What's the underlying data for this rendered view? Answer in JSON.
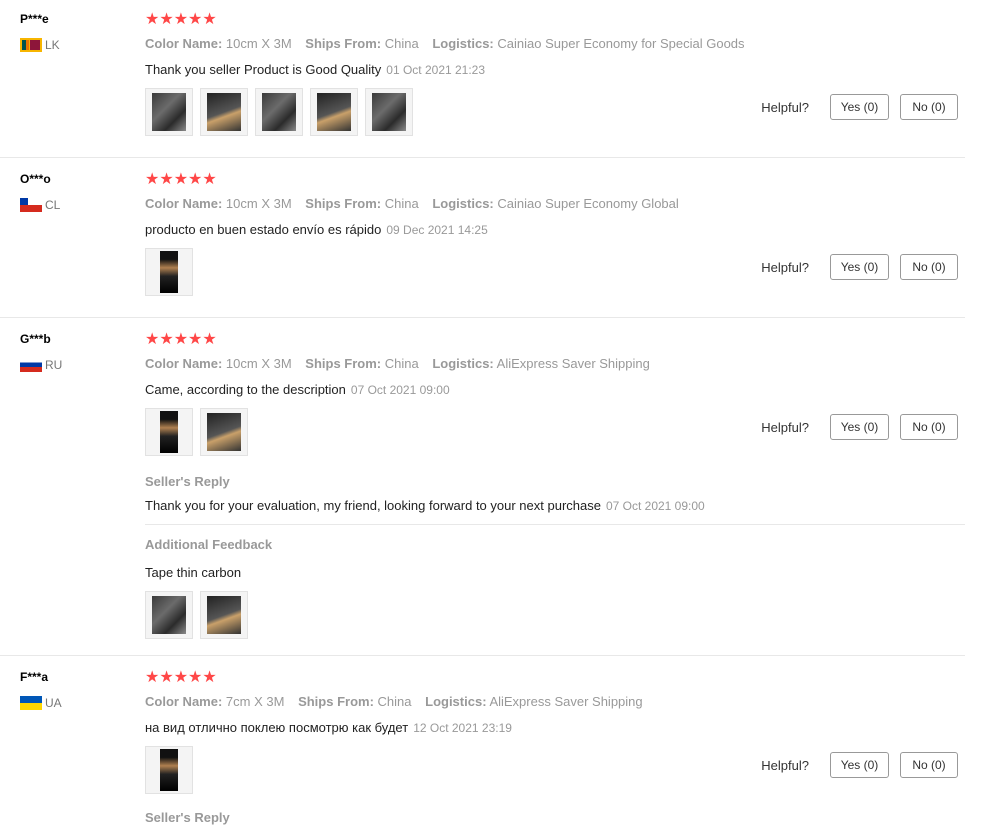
{
  "labels": {
    "color_name": "Color Name:",
    "ships_from": "Ships From:",
    "logistics": "Logistics:",
    "helpful": "Helpful?",
    "stars": "★★★★★"
  },
  "reviews": [
    {
      "user": "P***e",
      "country": "LK",
      "color": "10cm X 3M",
      "ships": "China",
      "logistics": "Cainiao Super Economy for Special Goods",
      "text": "Thank you seller Product is Good Quality",
      "date": "01 Oct 2021 21:23",
      "yes": "Yes (0)",
      "no": "No (0)",
      "rating": 5
    },
    {
      "user": "O***o",
      "country": "CL",
      "color": "10cm X 3M",
      "ships": "China",
      "logistics": "Cainiao Super Economy Global",
      "text": "producto en buen estado envío es rápido",
      "date": "09 Dec 2021 14:25",
      "yes": "Yes (0)",
      "no": "No (0)",
      "rating": 5
    },
    {
      "user": "G***b",
      "country": "RU",
      "color": "10cm X 3M",
      "ships": "China",
      "logistics": "AliExpress Saver Shipping",
      "text": "Came, according to the description",
      "date": "07 Oct 2021 09:00",
      "yes": "Yes (0)",
      "no": "No (0)",
      "rating": 5,
      "seller_reply_title": "Seller's Reply",
      "seller_reply": "Thank you for your evaluation, my friend, looking forward to your next purchase",
      "seller_reply_date": "07 Oct 2021 09:00",
      "additional_title": "Additional Feedback",
      "additional_text": "Tape thin carbon"
    },
    {
      "user": "F***a",
      "country": "UA",
      "color": "7cm X 3M",
      "ships": "China",
      "logistics": "AliExpress Saver Shipping",
      "text": "на вид отлично поклею посмотрю как будет",
      "date": "12 Oct 2021 23:19",
      "yes": "Yes (0)",
      "no": "No (0)",
      "rating": 5,
      "seller_reply_title": "Seller's Reply"
    }
  ]
}
